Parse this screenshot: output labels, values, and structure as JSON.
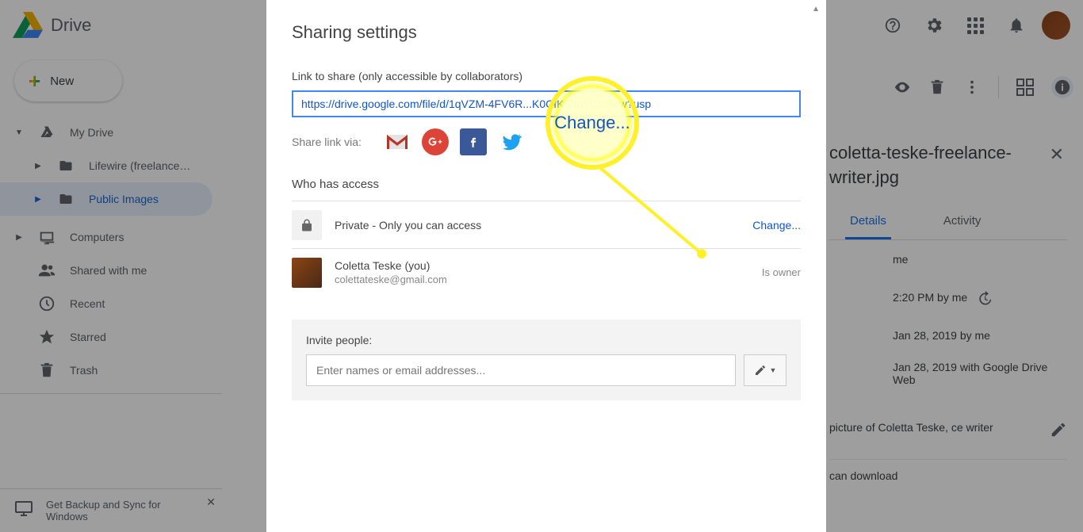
{
  "app": {
    "name": "Drive"
  },
  "new_button": "New",
  "nav": {
    "my_drive": "My Drive",
    "lifewire": "Lifewire (freelance…",
    "public_images": "Public Images",
    "computers": "Computers",
    "shared": "Shared with me",
    "recent": "Recent",
    "starred": "Starred",
    "trash": "Trash"
  },
  "backup_banner": "Get Backup and Sync for Windows",
  "details": {
    "filename": "coletta-teske-freelance-writer.jpg",
    "tabs": {
      "details": "Details",
      "activity": "Activity"
    },
    "owner_label": "me",
    "modified": "2:20 PM by me",
    "line2": "Jan 28, 2019 by me",
    "line3": "Jan 28, 2019 with Google Drive Web",
    "description": "picture of Coletta Teske, ce writer",
    "download": "can download"
  },
  "dialog": {
    "title": "Sharing settings",
    "link_label": "Link to share (only accessible by collaborators)",
    "link_value_left": "https://drive.google.com/file/d/1qVZM-4FV6R",
    "link_value_right": "K0CfK6IaW0z/view?usp",
    "share_via": "Share link via:",
    "who_title": "Who has access",
    "private_text": "Private - Only you can access",
    "change": "Change...",
    "owner_name": "Coletta Teske (you)",
    "owner_email": "colettateske@gmail.com",
    "owner_role": "Is owner",
    "invite_label": "Invite people:",
    "invite_placeholder": "Enter names or email addresses..."
  },
  "highlight": "Change..."
}
